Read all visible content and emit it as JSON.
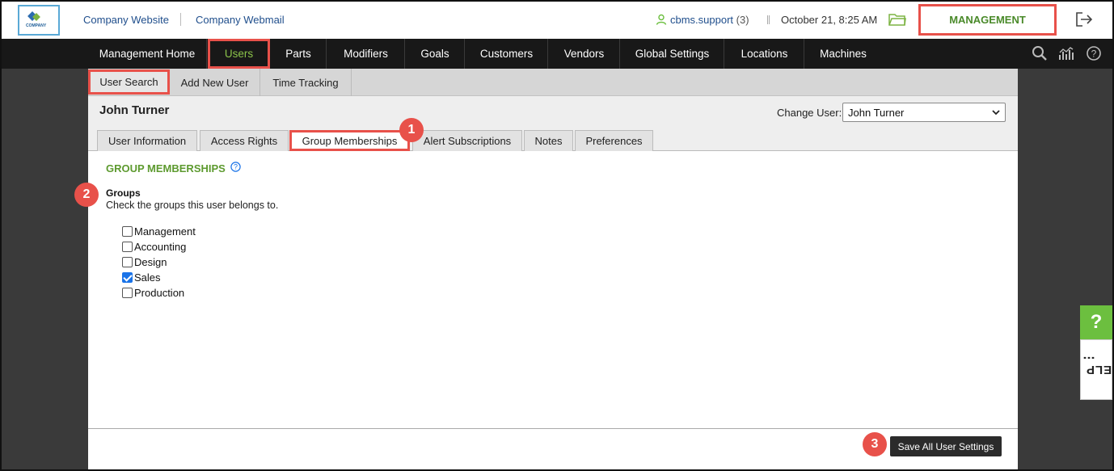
{
  "topbar": {
    "logo_text": "COMPANY",
    "links": [
      "Company Website",
      "Company Webmail"
    ],
    "user": "cbms.support",
    "user_count": "(3)",
    "datetime": "October 21, 8:25 AM",
    "management_label": "MANAGEMENT"
  },
  "nav": {
    "items": [
      "Management Home",
      "Users",
      "Parts",
      "Modifiers",
      "Goals",
      "Customers",
      "Vendors",
      "Global Settings",
      "Locations",
      "Machines"
    ],
    "active": "Users"
  },
  "subnav": {
    "items": [
      "User Search",
      "Add New User",
      "Time Tracking"
    ],
    "active": "User Search"
  },
  "panel": {
    "user_title": "John Turner",
    "change_user_label": "Change User:",
    "change_user_value": "John Turner"
  },
  "tabs": {
    "items": [
      "User Information",
      "Access Rights",
      "Group Memberships",
      "Alert Subscriptions",
      "Notes",
      "Preferences"
    ],
    "active": "Group Memberships"
  },
  "content": {
    "section_title": "GROUP MEMBERSHIPS",
    "groups_title": "Groups",
    "groups_desc": "Check the groups this user belongs to.",
    "groups": [
      {
        "label": "Management",
        "checked": false
      },
      {
        "label": "Accounting",
        "checked": false
      },
      {
        "label": "Design",
        "checked": false
      },
      {
        "label": "Sales",
        "checked": true
      },
      {
        "label": "Production",
        "checked": false
      }
    ]
  },
  "footer": {
    "save_label": "Save All User Settings"
  },
  "badges": [
    "1",
    "2",
    "3"
  ],
  "help": {
    "q": "?",
    "label": "HELP"
  },
  "colors": {
    "accent_green": "#5d9a2f",
    "highlight_red": "#e8514a",
    "nav_bg": "#181818"
  }
}
